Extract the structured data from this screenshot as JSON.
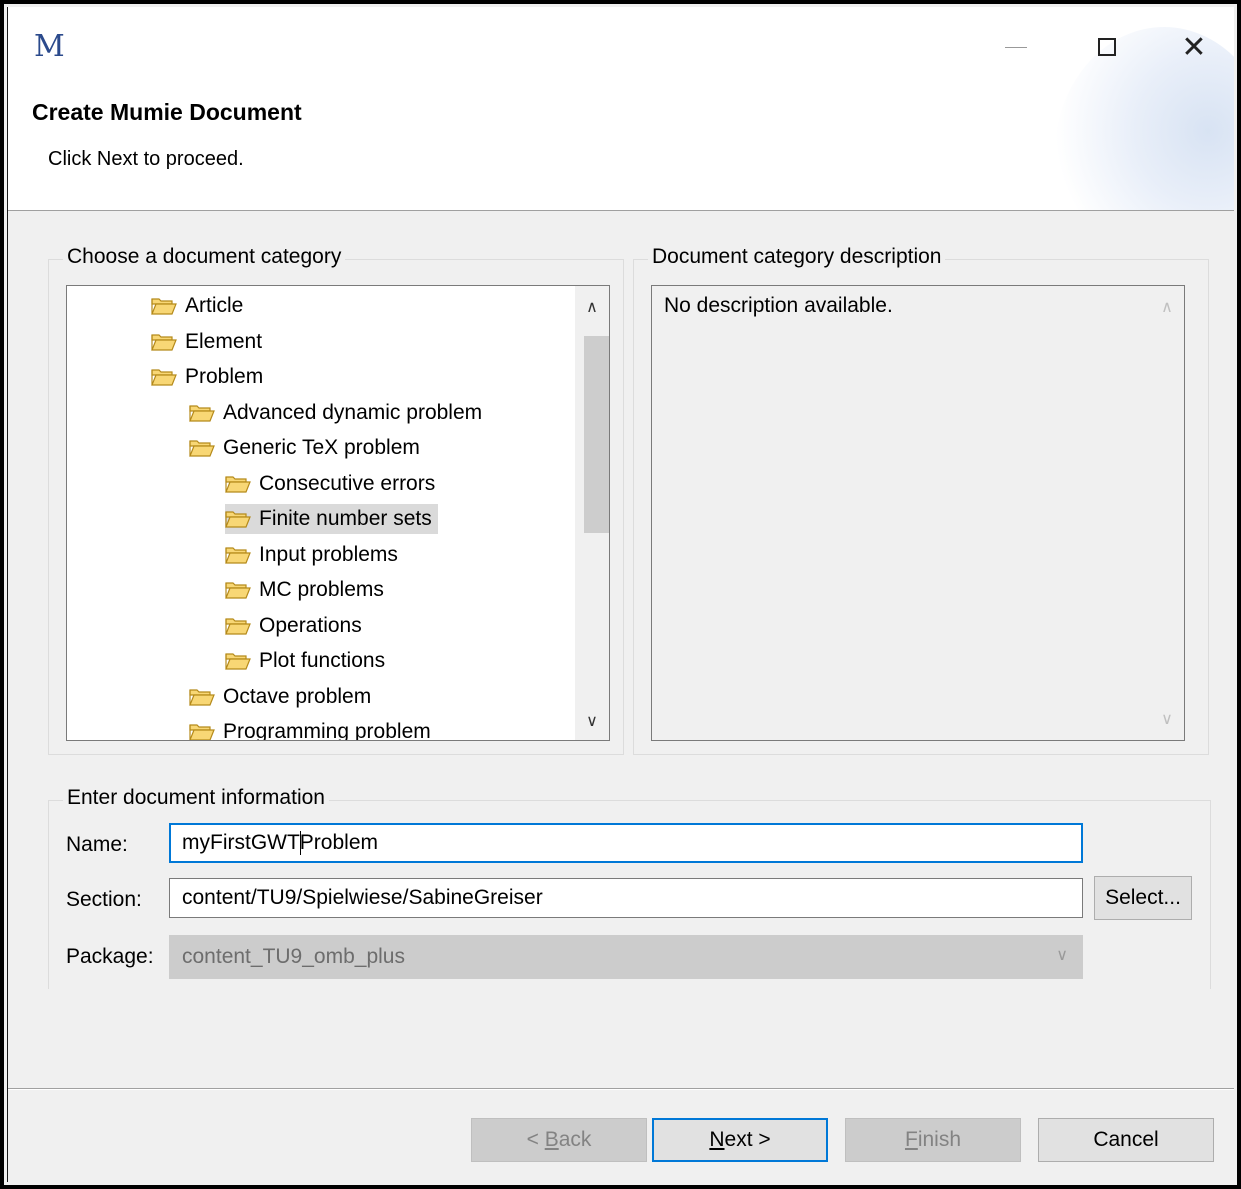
{
  "window": {
    "app_icon_letter": "M",
    "title": "Create Mumie Document",
    "subtitle": "Click Next to proceed."
  },
  "category_group": {
    "label": "Choose a document category",
    "items": [
      {
        "label": "Article",
        "level": 0,
        "selected": false
      },
      {
        "label": "Element",
        "level": 0,
        "selected": false
      },
      {
        "label": "Problem",
        "level": 0,
        "selected": false
      },
      {
        "label": "Advanced dynamic problem",
        "level": 1,
        "selected": false
      },
      {
        "label": "Generic TeX problem",
        "level": 1,
        "selected": false
      },
      {
        "label": "Consecutive errors",
        "level": 2,
        "selected": false
      },
      {
        "label": "Finite number sets",
        "level": 2,
        "selected": true
      },
      {
        "label": "Input problems",
        "level": 2,
        "selected": false
      },
      {
        "label": "MC problems",
        "level": 2,
        "selected": false
      },
      {
        "label": "Operations",
        "level": 2,
        "selected": false
      },
      {
        "label": "Plot functions",
        "level": 2,
        "selected": false
      },
      {
        "label": "Octave problem",
        "level": 1,
        "selected": false
      },
      {
        "label": "Programming problem",
        "level": 1,
        "selected": false
      }
    ]
  },
  "description_group": {
    "label": "Document category description",
    "text": "No description available."
  },
  "info_group": {
    "label": "Enter document information",
    "name_label": "Name:",
    "name_value_before": "myFirstGWT",
    "name_value_after": "Problem",
    "section_label": "Section:",
    "section_value": "content/TU9/Spielwiese/SabineGreiser",
    "select_button": "Select...",
    "package_label": "Package:",
    "package_value": "content_TU9_omb_plus"
  },
  "buttons": {
    "back_prefix": "< ",
    "back_mnemonic": "B",
    "back_rest": "ack",
    "next_mnemonic": "N",
    "next_rest": "ext >",
    "finish_mnemonic": "F",
    "finish_rest": "inish",
    "cancel": "Cancel"
  },
  "colors": {
    "accent": "#0078d7",
    "folder_fill": "#f8d775",
    "folder_stroke": "#b58a1a"
  }
}
